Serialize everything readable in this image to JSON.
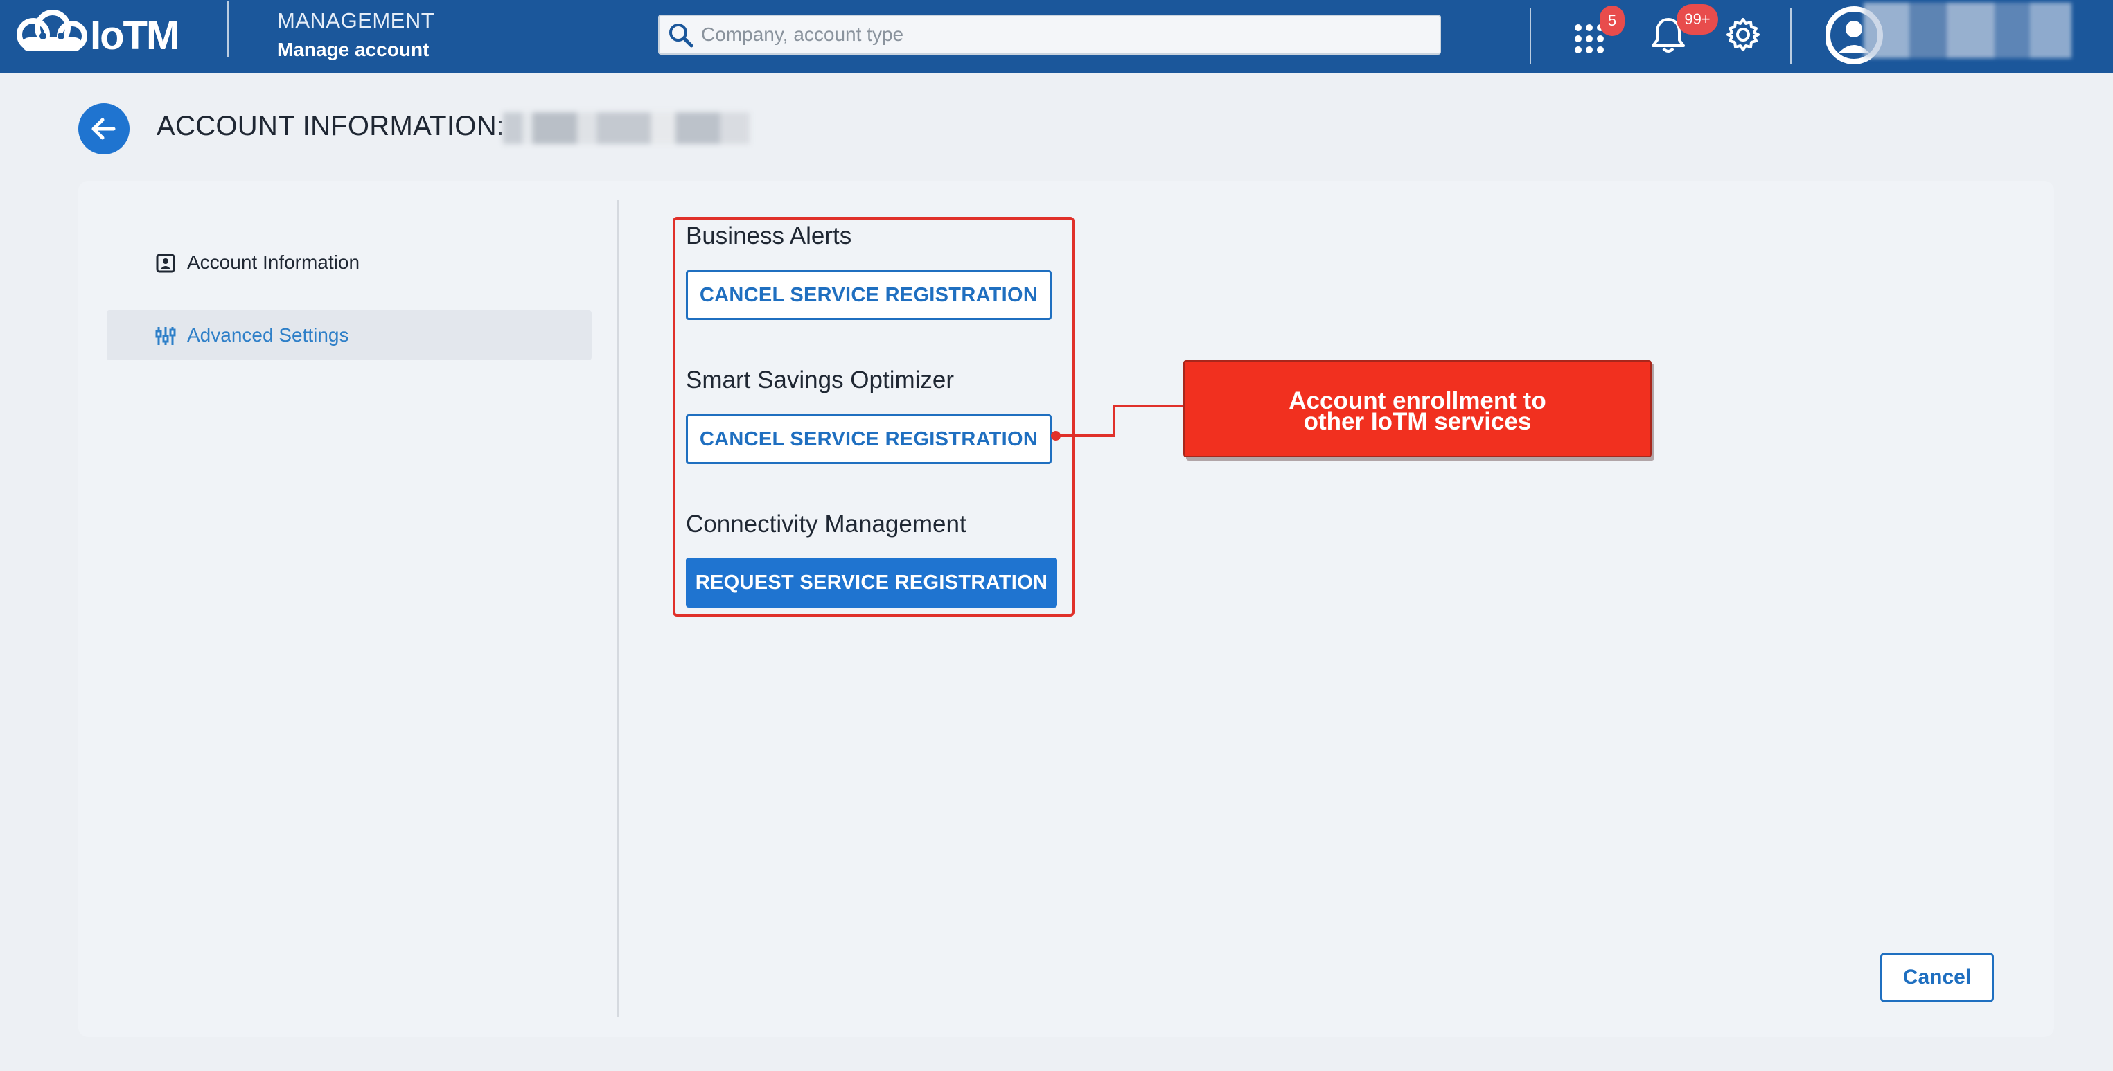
{
  "header": {
    "logo_text": "IoTM",
    "section_title": "MANAGEMENT",
    "section_subtitle": "Manage account",
    "search_placeholder": "Company, account type",
    "apps_badge": "5",
    "notifications_badge": "99+"
  },
  "page": {
    "title": "ACCOUNT INFORMATION:"
  },
  "sidebar": {
    "items": [
      {
        "label": "Account Information",
        "icon": "user-card-icon",
        "active": false
      },
      {
        "label": "Advanced Settings",
        "icon": "sliders-icon",
        "active": true
      }
    ]
  },
  "services": [
    {
      "name": "Business Alerts",
      "button": "CANCEL SERVICE REGISTRATION"
    },
    {
      "name": "Smart Savings Optimizer",
      "button": "CANCEL SERVICE REGISTRATION"
    },
    {
      "name": "Connectivity Management",
      "button": "REQUEST SERVICE REGISTRATION"
    }
  ],
  "annotation": {
    "line1": "Account enrollment to",
    "line2": "other IoTM services",
    "color": "#f1301f"
  },
  "footer": {
    "cancel_label": "Cancel"
  },
  "colors": {
    "header_bg": "#1b579b",
    "primary": "#1f74d0",
    "badge": "#e84c4c"
  }
}
